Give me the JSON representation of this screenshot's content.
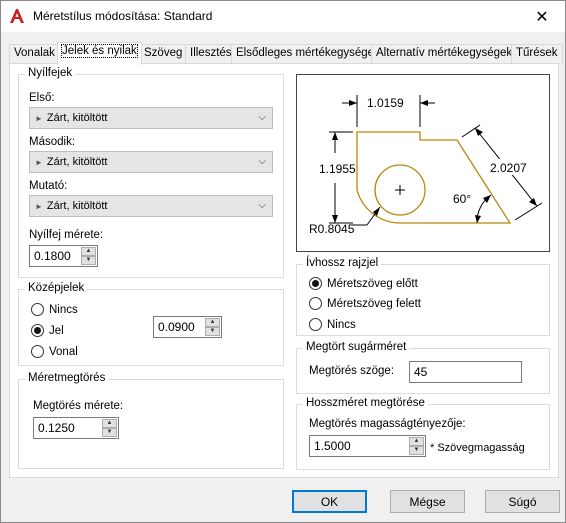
{
  "window": {
    "title": "Méretstílus módosítása: Standard",
    "close": "✕"
  },
  "tabs": [
    {
      "label": "Vonalak"
    },
    {
      "label": "Jelek és nyilak"
    },
    {
      "label": "Szöveg"
    },
    {
      "label": "Illesztés"
    },
    {
      "label": "Elsődleges mértékegységek"
    },
    {
      "label": "Alternatív mértékegységek"
    },
    {
      "label": "Tűrések"
    }
  ],
  "arrowheads": {
    "title": "Nyílfejek",
    "first_label": "Első:",
    "first_value": "Zárt, kitöltött",
    "second_label": "Második:",
    "second_value": "Zárt, kitöltött",
    "leader_label": "Mutató:",
    "leader_value": "Zárt, kitöltött",
    "size_label": "Nyílfej mérete:",
    "size_value": "0.1800"
  },
  "center_marks": {
    "title": "Középjelek",
    "options": [
      "Nincs",
      "Jel",
      "Vonal"
    ],
    "selected": "Jel",
    "size_value": "0.0900"
  },
  "dim_break": {
    "title": "Méretmegtörés",
    "size_label": "Megtörés mérete:",
    "size_value": "0.1250"
  },
  "preview": {
    "dim_top": "1.0159",
    "dim_left": "1.1955",
    "dim_right": "2.0207",
    "angle": "60°",
    "radius": "R0.8045"
  },
  "arc_length": {
    "title": "Ívhossz rajzjel",
    "options": [
      "Méretszöveg előtt",
      "Méretszöveg felett",
      "Nincs"
    ],
    "selected": "Méretszöveg előtt"
  },
  "radius_jog": {
    "title": "Megtört sugárméret",
    "angle_label": "Megtörés szöge:",
    "angle_value": "45"
  },
  "linear_jog": {
    "title": "Hosszméret megtörése",
    "factor_label": "Megtörés magasságtényezője:",
    "factor_value": "1.5000",
    "factor_suffix": "* Szövegmagasság"
  },
  "buttons": {
    "ok": "OK",
    "cancel": "Mégse",
    "help": "Súgó"
  },
  "colors": {
    "accent": "#0078d7",
    "preview_outline": "#b8860b",
    "app_icon": "#cc1f1f"
  }
}
